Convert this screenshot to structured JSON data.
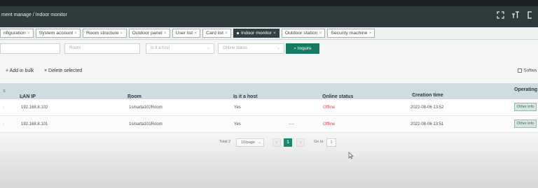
{
  "topbar": {
    "breadcrumb": "ment manage / Indoor monitor",
    "icons": [
      "fullscreen-icon",
      "font-size-icon",
      "exit-icon"
    ]
  },
  "tabs": [
    {
      "label": "nfiguration",
      "active": false
    },
    {
      "label": "System account",
      "active": false
    },
    {
      "label": "Room structure",
      "active": false
    },
    {
      "label": "Outdoor panel",
      "active": false
    },
    {
      "label": "User list",
      "active": false
    },
    {
      "label": "Card list",
      "active": false
    },
    {
      "label": "Indoor monitor",
      "active": true
    },
    {
      "label": "Outdoor station",
      "active": false
    },
    {
      "label": "Security machine",
      "active": false
    }
  ],
  "filters": {
    "room_placeholder": "Room",
    "host_placeholder": "Is it a host",
    "status_placeholder": "Online status",
    "inquire_label": "Inquire"
  },
  "actions": {
    "add_label": "+ Add in bulk",
    "delete_label": "× Delete selected",
    "software_label": "Softwa"
  },
  "table": {
    "columns": [
      "LAN IP",
      "Room",
      "Is it a host",
      "Online status",
      "Creation time",
      "Operating"
    ],
    "rows": [
      {
        "ip": "192.168.8.102",
        "room": "1smarta102Room",
        "host": "Yes",
        "status": "Offline",
        "time": "2022-08-06 13:52",
        "action": "Other info"
      },
      {
        "ip": "192.168.8.101",
        "room": "1smarta101Room",
        "host": "Yes",
        "status": "Offline",
        "time": "2022-08-06 13:51",
        "action": "Other info"
      }
    ]
  },
  "pager": {
    "total": "Total 2",
    "per_page": "10/page",
    "current": "1",
    "goto_label": "Go to",
    "goto_value": "1"
  }
}
